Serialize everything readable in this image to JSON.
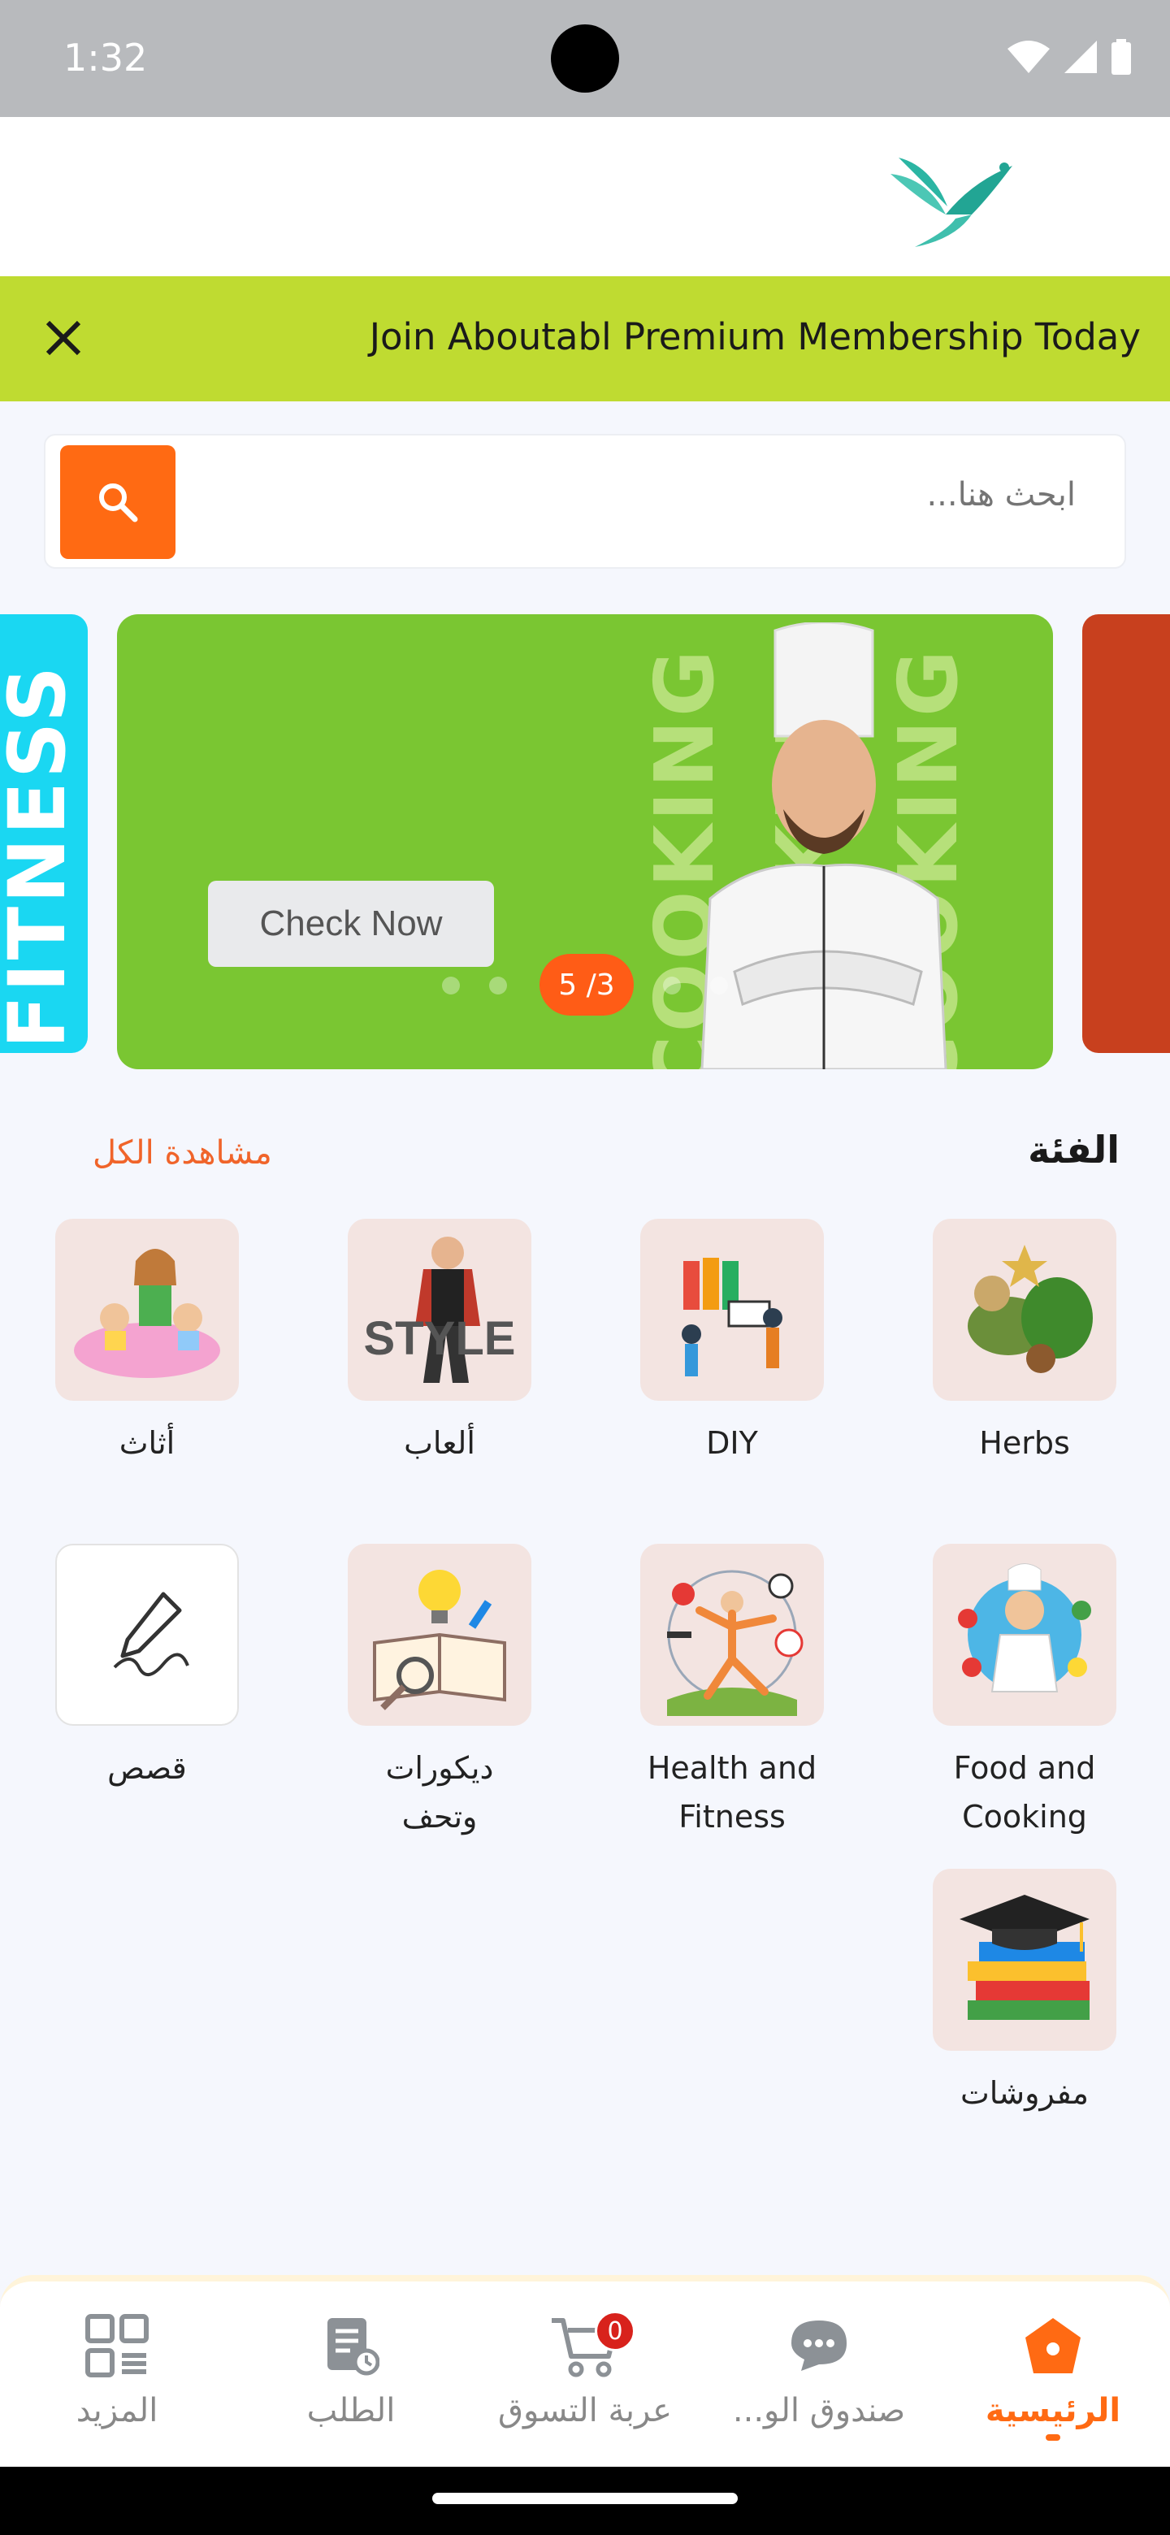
{
  "status_bar": {
    "time": "1:32"
  },
  "header": {
    "logo_icon": "bird-logo-icon"
  },
  "promo": {
    "text": "Join Aboutabl Premium Membership Today",
    "close_icon": "close-icon"
  },
  "search": {
    "placeholder": "ابحث هنا...",
    "button_icon": "search-icon"
  },
  "carousel": {
    "left_slide_text": "FITNESS",
    "main_slide_text": "COOKING",
    "button_label": "Check Now",
    "pager": "5 /3"
  },
  "categories": {
    "title": "الفئة",
    "view_all": "مشاهدة الكل",
    "items": [
      {
        "label": "Herbs",
        "icon": "herbs-icon"
      },
      {
        "label": "DIY",
        "icon": "diy-icon"
      },
      {
        "label": "ألعاب",
        "icon": "style-icon"
      },
      {
        "label": "أثاث",
        "icon": "family-icon"
      },
      {
        "label": "Food and Cooking",
        "icon": "chef-icon"
      },
      {
        "label": "Health and Fitness",
        "icon": "fitness-icon"
      },
      {
        "label": "ديكورات وتحف",
        "icon": "book-idea-icon"
      },
      {
        "label": "قصص",
        "icon": "pen-icon"
      },
      {
        "label": "مفروشات",
        "icon": "graduation-icon"
      }
    ]
  },
  "nav": {
    "items": [
      {
        "label": "الرئيسية",
        "icon": "home-icon",
        "active": true
      },
      {
        "label": "صندوق الو...",
        "icon": "chat-icon"
      },
      {
        "label": "عربة التسوق",
        "icon": "cart-icon",
        "badge": "0"
      },
      {
        "label": "الطلب",
        "icon": "orders-icon"
      },
      {
        "label": "المزيد",
        "icon": "grid-icon"
      }
    ]
  },
  "colors": {
    "accent": "#ff6a13",
    "promo": "#bfdb31",
    "slide": "#7ac632"
  }
}
